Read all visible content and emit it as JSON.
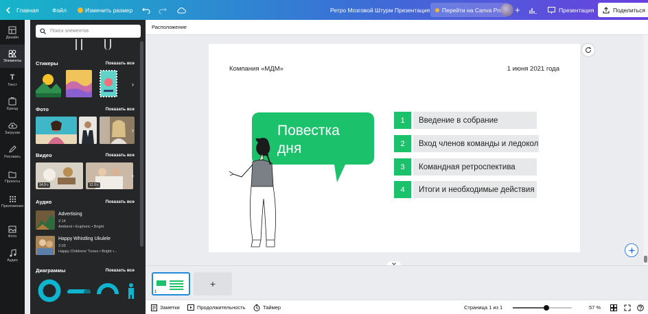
{
  "topbar": {
    "back_icon": "chevron-left-icon",
    "home": "Главная",
    "file": "Файл",
    "resize": "Изменить размер",
    "doc_title": "Ретро Мозговой Штурм Презентация",
    "pro": "Перейти на Canva Pro",
    "present": "Презентация",
    "share": "Поделиться"
  },
  "rail": [
    {
      "label": "Дизайн",
      "icon": "layout-icon"
    },
    {
      "label": "Элементы",
      "icon": "shapes-icon",
      "active": true
    },
    {
      "label": "Текст",
      "icon": "text-icon"
    },
    {
      "label": "Бренд",
      "icon": "brand-icon"
    },
    {
      "label": "Загрузки",
      "icon": "cloud-upload-icon"
    },
    {
      "label": "Рисовать",
      "icon": "pen-icon"
    },
    {
      "label": "Проекты",
      "icon": "folder-icon"
    },
    {
      "label": "Приложения",
      "icon": "apps-grid-icon"
    },
    {
      "label": "Фото",
      "icon": "photo-icon"
    },
    {
      "label": "Аудио",
      "icon": "music-note-icon"
    }
  ],
  "panel": {
    "search_placeholder": "Поиск элементов",
    "show_all": "Показать все",
    "sections": {
      "stickers": "Стикеры",
      "photos": "Фото",
      "videos": "Видео",
      "audio": "Аудио",
      "charts": "Диаграммы"
    },
    "videos": [
      {
        "duration": "14.0 с"
      },
      {
        "duration": "12.0 с"
      }
    ],
    "audio": [
      {
        "title": "Advertising",
        "duration": "2:14",
        "tags": "Ambient • Euphoric • Bright"
      },
      {
        "title": "Happy Whistling Ukulele",
        "duration": "2:03",
        "tags": "Happy Childrens' Tunes • Bright •..."
      }
    ]
  },
  "editor": {
    "position_label": "Расположение",
    "slide": {
      "company": "Компания «МДМ»",
      "date": "1 июня 2021 года",
      "bubble_line1": "Повестка",
      "bubble_line2": "дня",
      "accent": "#1cc26b",
      "agenda": [
        {
          "num": "1",
          "text": "Введение в собрание"
        },
        {
          "num": "2",
          "text": "Вход членов команды и ледокол"
        },
        {
          "num": "3",
          "text": "Командная ретроспектива"
        },
        {
          "num": "4",
          "text": "Итоги и необходимые действия"
        }
      ]
    },
    "page_num": "1",
    "add_page": "+"
  },
  "bottombar": {
    "notes": "Заметки",
    "duration": "Продолжительность",
    "timer": "Таймер",
    "page_info": "Страница 1 из 1",
    "zoom": "57 %",
    "zoom_level": 0.57
  }
}
